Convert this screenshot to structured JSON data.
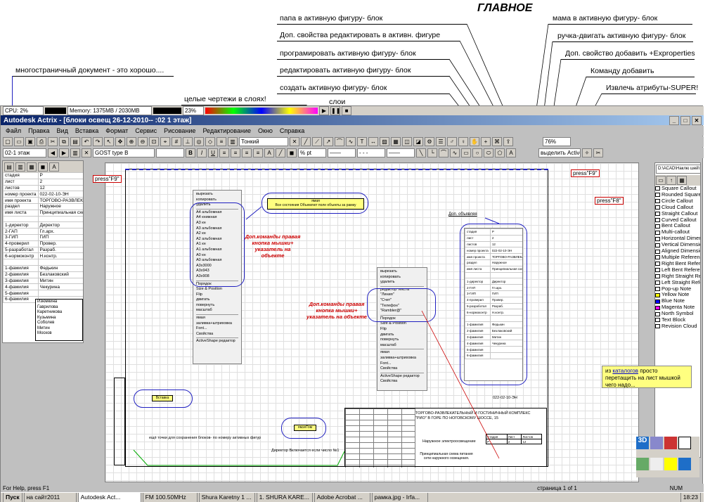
{
  "heading": "ГЛАВНОЕ",
  "annotations": {
    "multipage": "многостраничный документ - это хорошо....",
    "whole_drawings": "целые чертежи  в слоях!",
    "layers": "слои",
    "papa": "папа в  активную фигуру- блок",
    "props_edit": "Доп. свойства редактировать в  активн. фигуре",
    "program": "програмировать активную фигуру- блок",
    "edit_active": "редактировать активную фигуру- блок",
    "create_active": "создать активную фигуру- блок",
    "mama": "мама в  активную фигуру- блок",
    "handle": "ручка-двигать  активную фигуру- блок",
    "add_prop": "Доп. свойство добавить +Exproperties",
    "add_command": "Команду добавить",
    "extract": "Извлечь атрибуты-SUPER!",
    "press_f9": "press\"F9\"",
    "press_f8": "press\"F8\"",
    "catalog_1": "из ",
    "catalog_link": "каталогов",
    "catalog_2": " просто перетащить на лист мышкой чего надо..."
  },
  "window": {
    "perf": "CPU: 2%",
    "memory": "Memory: 1375MB / 2030MB",
    "perf_pct": "23%",
    "title": "Autodesk Actrix - [блоки освещ 26-12-2010-- :02 1 этаж]",
    "menu": [
      "Файл",
      "Правка",
      "Вид",
      "Вставка",
      "Формат",
      "Сервис",
      "Рисование",
      "Редактирование",
      "Окно",
      "Справка"
    ],
    "layer_combo": "02-1 этаж",
    "font_combo": "GOST type B",
    "pt_combo": "% pt",
    "linetype_combo": "Тонкий",
    "zoom": "76%",
    "shapes_label": "выделить ActiveShape"
  },
  "props_panel": {
    "rows": [
      [
        "стадия",
        "Р"
      ],
      [
        "лист",
        "2"
      ],
      [
        "листов",
        "12"
      ],
      [
        "номер проекта",
        "022-02-10-ЭН"
      ],
      [
        "имя проекта",
        "ТОРГОВО-РАЗВЛЕКАТЕЛ"
      ],
      [
        "раздел",
        "Наружное"
      ],
      [
        "имя листа",
        "Принципиальная схема"
      ],
      [
        "",
        ""
      ],
      [
        "1-директор",
        "Директор"
      ],
      [
        "2-ГАП",
        "Гл.арх."
      ],
      [
        "3-ГИП",
        "ГИП"
      ],
      [
        "4-проверил",
        "Провер."
      ],
      [
        "5-разработал",
        "Разраб."
      ],
      [
        "6-нормоконтр",
        "Н.контр."
      ],
      [
        "",
        ""
      ],
      [
        "1-фамилия",
        "Федькин"
      ],
      [
        "2-фамилия",
        "Безлаковский"
      ],
      [
        "3-фамилия",
        "Митин"
      ],
      [
        "4-фамилия",
        "Чекурина"
      ],
      [
        "5-фамилия",
        ""
      ],
      [
        "6-фамилия",
        ""
      ]
    ],
    "dropdown": [
      "Изюмкина",
      "Гаврилова",
      "Каретникова",
      "Кузьмина",
      "Соболев",
      "Митин",
      "Москов"
    ]
  },
  "context_menu": {
    "items": [
      "вырезать",
      "копировать",
      "удалить",
      "",
      "А4 альбомная",
      "А4 книжная",
      "А3 кн",
      "А3 альбомная",
      "А2 кн",
      "А2 альбомная",
      "А1 кн",
      "А1 альбомная",
      "А0 кн",
      "А0 альбомная",
      "А3х3000",
      "А3х943",
      "А3х908",
      "",
      "Порядок",
      "Size & Position",
      "Flip",
      "двигать",
      "повернуть",
      "масштаб",
      "",
      "ямая",
      "заливка+штриховка",
      "Font...",
      "Свойства",
      "",
      "ActiveShape редактор"
    ],
    "red_note": "Доп.команды правая кнопка мышки+ указатель на объекте"
  },
  "context_menu_2": {
    "items": [
      "вырезать",
      "копировать",
      "удалить",
      "",
      "редактор текста",
      "\"Линия\"",
      "\"Счет\"",
      "\"Телефон\"",
      "\"Rambler@\"",
      "",
      "Порядок",
      "Size & Position",
      "Flip",
      "двигать",
      "повернуть",
      "масштаб",
      "",
      "ямая",
      "заливка+штриховка",
      "Font...",
      "Свойства",
      "",
      "ActiveShape редактор",
      "Свойства"
    ],
    "red_note": "Доп.команды правая кнопка мышки+ указатель на объекте"
  },
  "canvas": {
    "yellow_tag": "ямая",
    "yellow_text": "Все состояния Объемлют поле объекты за рамку",
    "yellow_small_1": "Вставка",
    "yellow_small_2": "ямэяТом",
    "dop_label": "Доп. объявляя",
    "bottom_note": "ещё точки для сохранения блоков- по номеру активных фигур",
    "bottom_note_2": "Директор Включается если число №1",
    "stamp_title": "ТОРГОВО-РАЗВЛЕКАТЕЛЬНЫЙ И ГОСТИНИЧНЫЙ КОМПЛЕКС \"РИО\" В ГОРЕ ПО НОГОВСКОМУ ШОССЕ, 15",
    "stamp_code": "022-02-10-ЭН",
    "stamp_mid": "Наружное электроосвещение",
    "stamp_mid_2": "Принципиальная схема питания сети наружного освещения.",
    "stamp_cells": [
      "Стадия",
      "Лист",
      "Листов",
      "Р",
      "2",
      "12"
    ]
  },
  "catalog": {
    "path": "D:\\ACAD\\Наклю шей\\Solu",
    "items": [
      "Square Callout",
      "Rounded Square Callout",
      "Circle Callout",
      "Cloud Callout",
      "Straight Callout",
      "Curved Callout",
      "Bent Callout",
      "Multi-callout",
      "Horizontal Dimension",
      "Vertical Dimension",
      "Aligned Dimension",
      "Multiple References",
      "Right Bent References",
      "Left Bent References",
      "Right Straight References",
      "Left Straight References",
      "Pop-up Note",
      "Yellow Note",
      "Blue Note",
      "Magenta Note",
      "North Symbol",
      "Text Block",
      "Revision Cloud"
    ]
  },
  "status": {
    "help": "For Help, press F1",
    "page": "страница 1 of 1",
    "num": "NUM"
  },
  "taskbar": {
    "start": "Пуск",
    "tasks": [
      "на сайт2011",
      "Autodesk Act...",
      "FM 100.50MHz",
      "Shura Karetny 1 ...",
      "1. SHURA KARE...",
      "Adobe Acrobat ...",
      "рамка.jpg - Irfa..."
    ],
    "clock": "18:23"
  },
  "colors": {
    "callout": "#2020c0",
    "note_red": "#cc0000",
    "title_start": "#0a246a"
  }
}
